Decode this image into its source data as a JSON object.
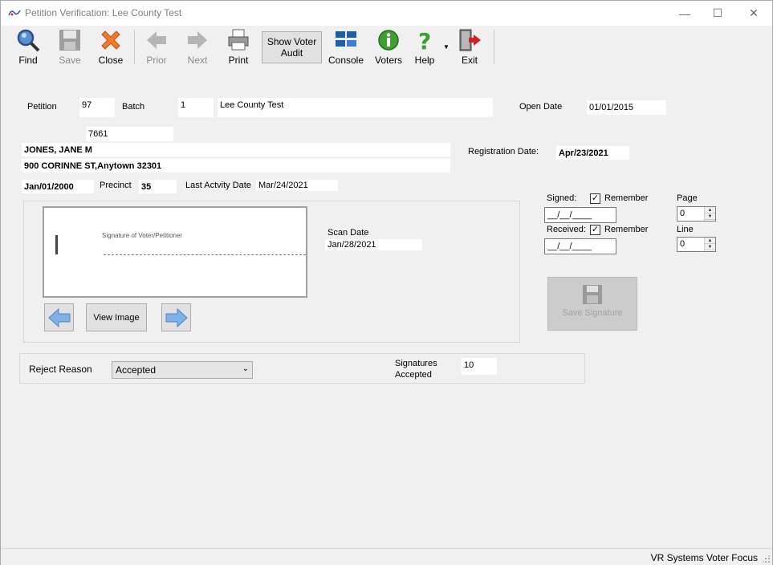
{
  "window": {
    "title": "Petition Verification: Lee County Test",
    "minimize": "—",
    "maximize": "☐",
    "close": "✕"
  },
  "toolbar": {
    "find": "Find",
    "save": "Save",
    "close": "Close",
    "prior": "Prior",
    "next": "Next",
    "print": "Print",
    "show_voter_audit": "Show Voter Audit",
    "console": "Console",
    "voters": "Voters",
    "help": "Help",
    "exit": "Exit"
  },
  "form": {
    "petition_label": "Petition",
    "petition_value": "97",
    "batch_label": "Batch",
    "batch_value": "1",
    "batch_name": "Lee County Test",
    "open_date_label": "Open Date",
    "open_date_value": "01/01/2015",
    "voter_id": "7661",
    "voter_name": "JONES, JANE M",
    "voter_address": "900 CORINNE ST,Anytown 32301",
    "registration_date_label": "Registration Date:",
    "registration_date_value": "Apr/23/2021",
    "dob": "Jan/01/2000",
    "precinct_label": "Precinct",
    "precinct_value": "35",
    "last_activity_label": "Last Actvity Date",
    "last_activity_value": "Mar/24/2021",
    "scan_date_label": "Scan Date",
    "scan_date_value": "Jan/28/2021",
    "view_image": "View Image",
    "image_caption": "Signature of Voter/Petitioner",
    "signed_label": "Signed:",
    "signed_remember": "Remember",
    "signed_value": "__/__/____",
    "received_label": "Received:",
    "received_remember": "Remember",
    "received_value": "__/__/____",
    "page_label": "Page",
    "page_value": "0",
    "line_label": "Line",
    "line_value": "0",
    "save_signature": "Save Signature",
    "reject_reason_label": "Reject Reason",
    "reject_reason_value": "Accepted",
    "signatures_accepted_label_1": "Signatures",
    "signatures_accepted_label_2": "Accepted",
    "signatures_accepted_value": "10"
  },
  "status": {
    "text": "VR Systems Voter Focus"
  }
}
